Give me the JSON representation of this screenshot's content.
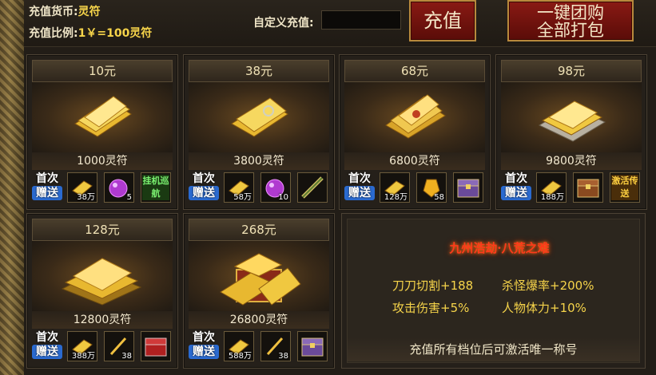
{
  "header": {
    "currency_label": "充值货币:",
    "currency_value": "灵符",
    "ratio_label": "充值比例:",
    "ratio_value": "1￥=100灵符",
    "custom_label": "自定义充值:",
    "custom_value": "",
    "recharge_label": "充值",
    "bundle_line1": "一键团购",
    "bundle_line2": "全部打包"
  },
  "gift_tag": {
    "line1": "首次",
    "line2": "赠送"
  },
  "packages": [
    {
      "price": "10元",
      "amount": "1000灵符",
      "gifts": [
        {
          "icon": "gold-sheet-icon",
          "count": "38万"
        },
        {
          "icon": "purple-orb-icon",
          "count": "5"
        },
        {
          "icon": "auto-patrol-icon",
          "text": "挂机巡航"
        }
      ]
    },
    {
      "price": "38元",
      "amount": "3800灵符",
      "gifts": [
        {
          "icon": "gold-sheet-icon",
          "count": "58万"
        },
        {
          "icon": "purple-orb-icon",
          "count": "10"
        },
        {
          "icon": "scroll-icon",
          "count": ""
        }
      ]
    },
    {
      "price": "68元",
      "amount": "6800灵符",
      "gifts": [
        {
          "icon": "gold-sheet-icon",
          "count": "128万"
        },
        {
          "icon": "gold-crystal-icon",
          "count": "58"
        },
        {
          "icon": "treasure-chest-icon",
          "count": ""
        }
      ]
    },
    {
      "price": "98元",
      "amount": "9800灵符",
      "gifts": [
        {
          "icon": "gold-sheet-icon",
          "count": "188万"
        },
        {
          "icon": "treasure-chest-icon",
          "count": ""
        },
        {
          "icon": "activate-teleport-icon",
          "text": "激活传送"
        }
      ]
    },
    {
      "price": "128元",
      "amount": "12800灵符",
      "gifts": [
        {
          "icon": "gold-sheet-icon",
          "count": "388万"
        },
        {
          "icon": "sword-icon",
          "count": "38"
        },
        {
          "icon": "red-chest-icon",
          "count": ""
        }
      ]
    },
    {
      "price": "268元",
      "amount": "26800灵符",
      "gifts": [
        {
          "icon": "gold-sheet-icon",
          "count": "588万"
        },
        {
          "icon": "sword-icon",
          "count": "38"
        },
        {
          "icon": "treasure-chest-icon",
          "count": ""
        }
      ]
    }
  ],
  "title_info": {
    "title": "九州浩劫·八荒之难",
    "stats": [
      "刀刀切割+188",
      "杀怪爆率+200%",
      "攻击伤害+5%",
      "人物体力+10%"
    ],
    "footer": "充值所有档位后可激活唯一称号"
  },
  "colors": {
    "gold": "#f6d44a",
    "red_button": "#8a1a14",
    "frame": "#25201a"
  }
}
